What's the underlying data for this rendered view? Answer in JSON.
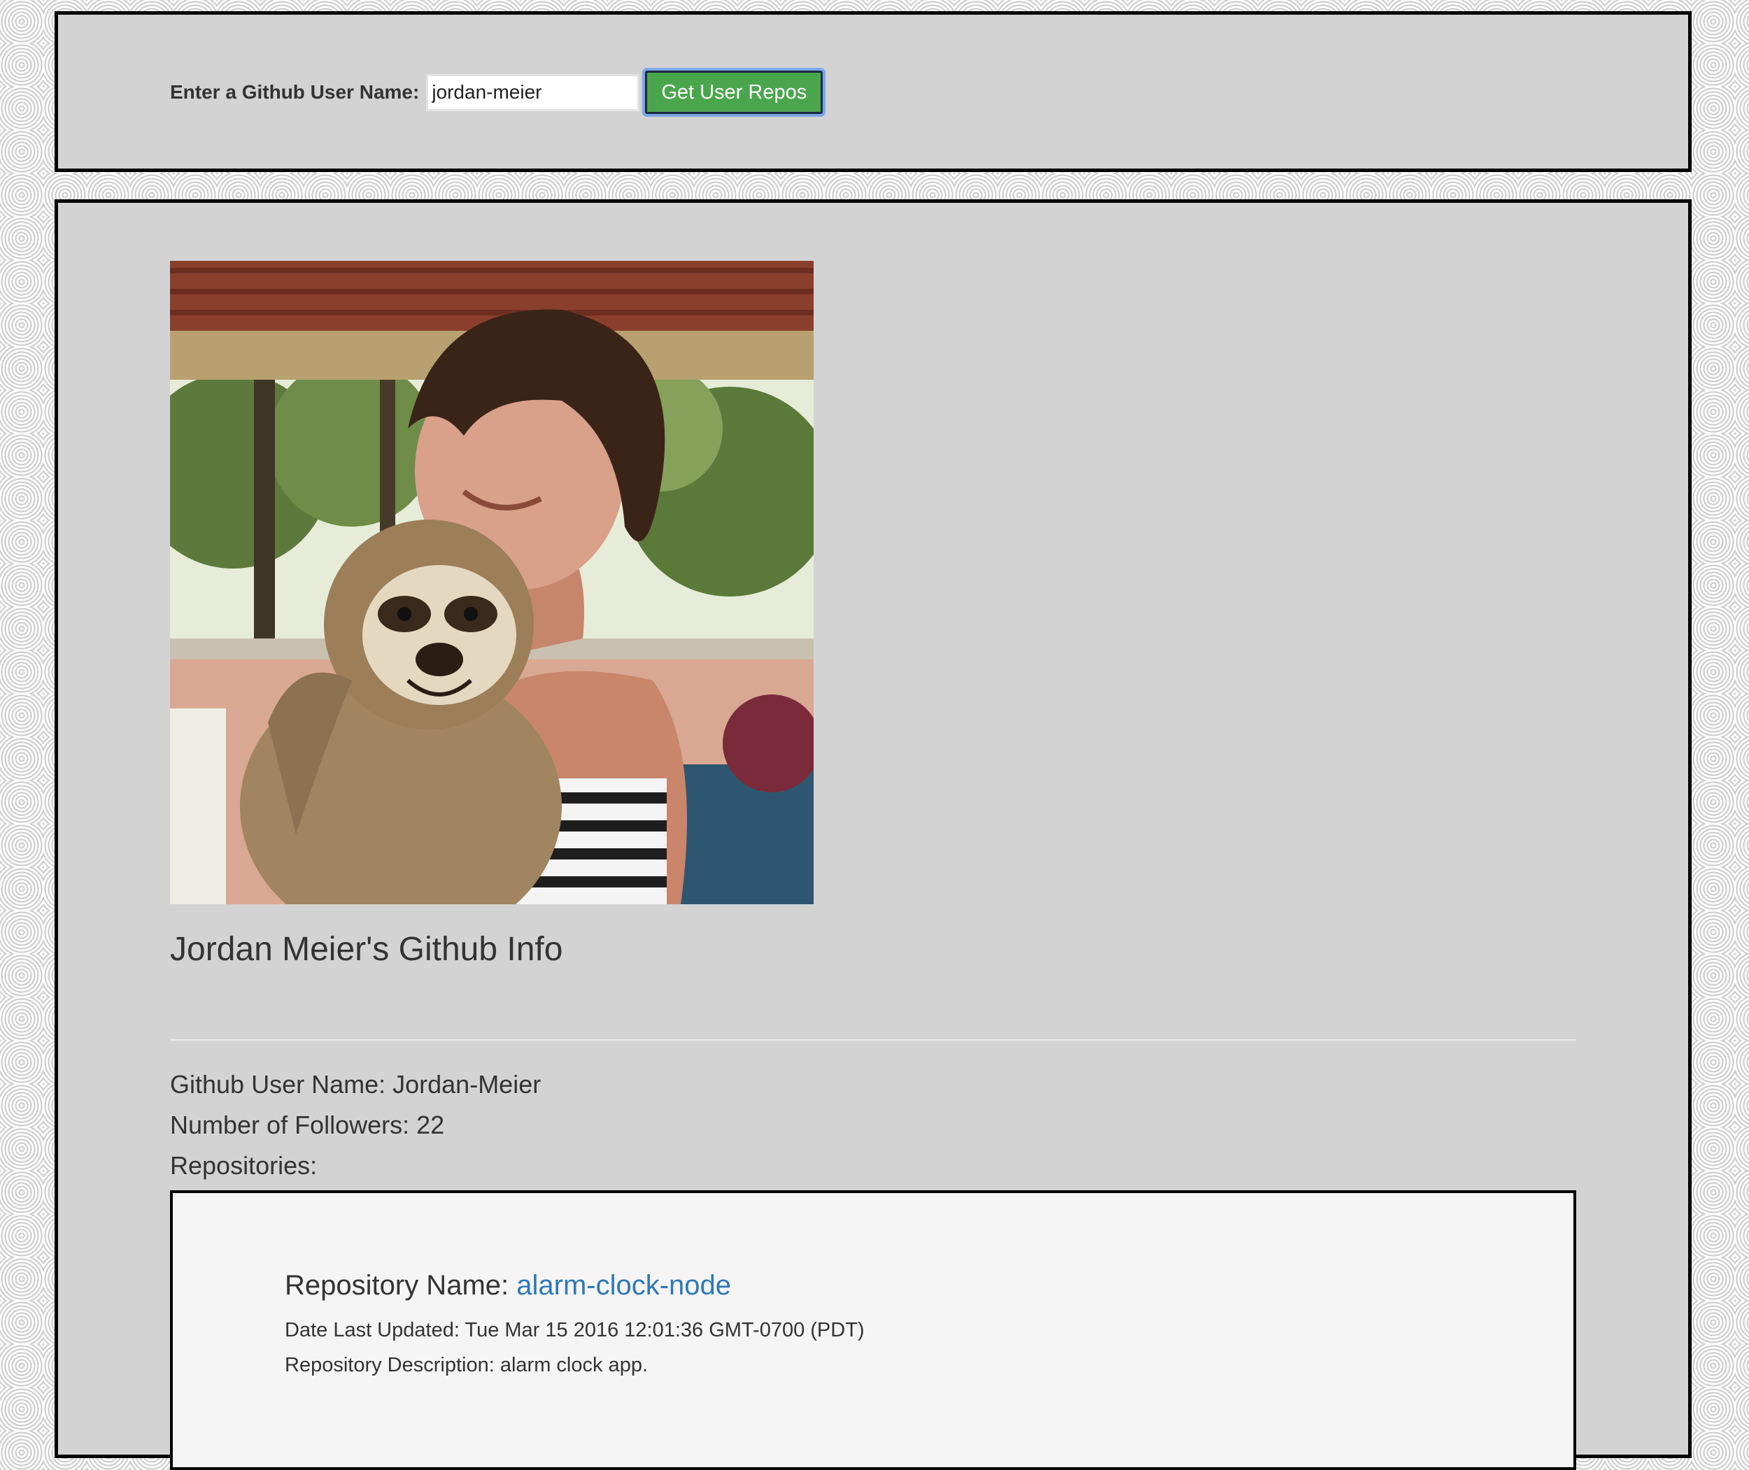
{
  "search": {
    "label": "Enter a Github User Name:",
    "value": "jordan-meier",
    "button_label": "Get User Repos"
  },
  "profile": {
    "heading": "Jordan Meier's Github Info",
    "username_label": "Github User Name:",
    "username": "Jordan-Meier",
    "followers_label": "Number of Followers:",
    "followers": "22",
    "repos_label": "Repositories:"
  },
  "repositories": [
    {
      "name_label": "Repository Name:",
      "name": "alarm-clock-node",
      "updated_label": "Date Last Updated:",
      "updated": "Tue Mar 15 2016 12:01:36 GMT-0700 (PDT)",
      "description_label": "Repository Description:",
      "description": "alarm clock app."
    }
  ],
  "colors": {
    "panel_bg": "#d3d3d3",
    "button_bg": "#4aa64c",
    "link": "#2f78b7",
    "card_bg": "#f5f5f5"
  },
  "icons": {
    "avatar": "user-avatar-photo"
  }
}
